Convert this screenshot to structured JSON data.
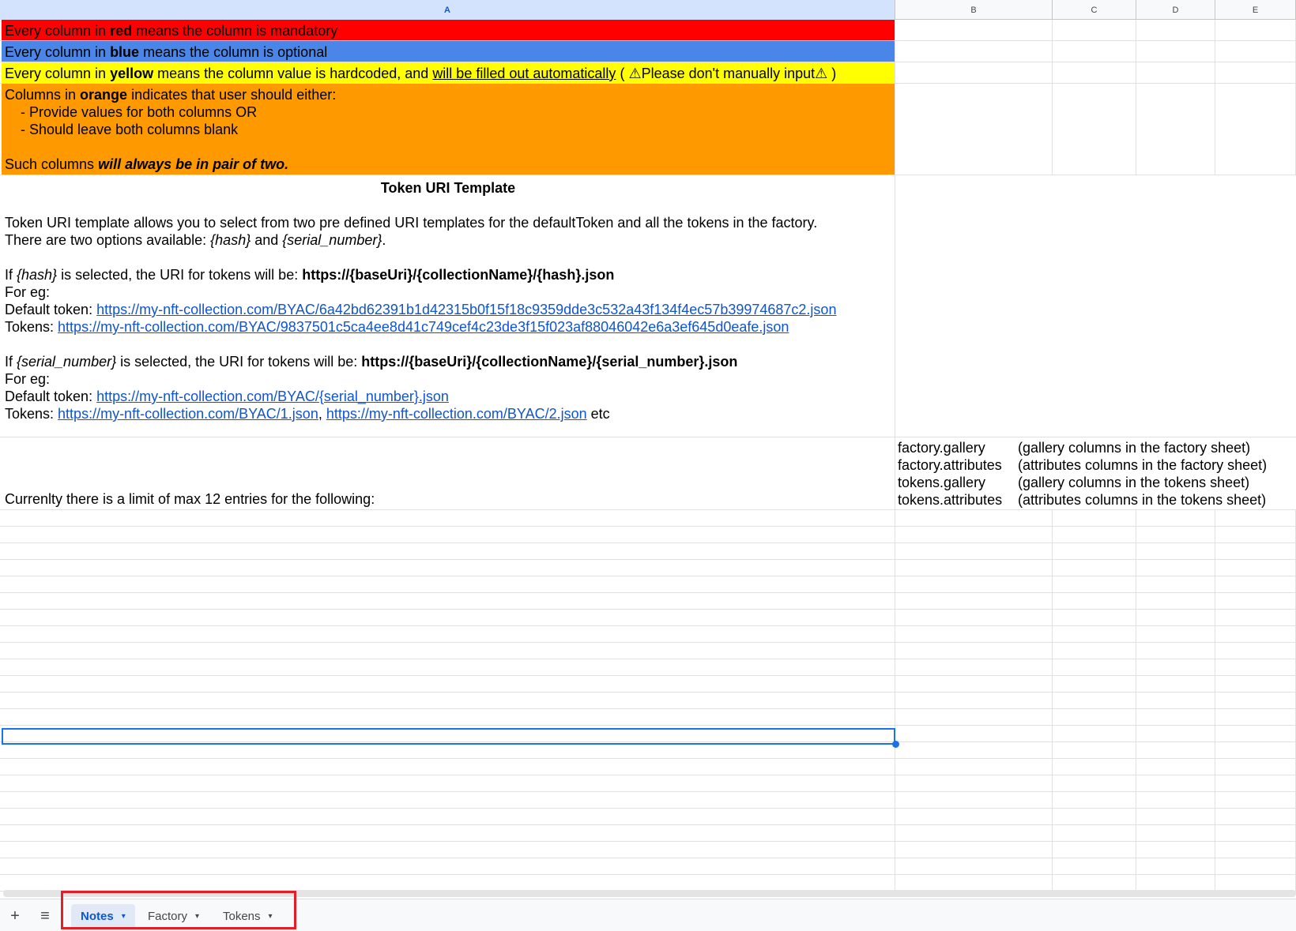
{
  "columns": [
    "A",
    "B",
    "C",
    "D",
    "E"
  ],
  "legend": {
    "red": {
      "pre": "Every column in ",
      "keyword": "red",
      "post": " means the column is mandatory",
      "color": "#ff0000"
    },
    "blue": {
      "pre": "Every column in ",
      "keyword": "blue",
      "post": " means the column is optional",
      "color": "#4a86e8"
    },
    "yellow": {
      "pre": "Every column in ",
      "keyword": "yellow",
      "mid": " means the column value is hardcoded, and ",
      "underlined": "will be filled out automatically",
      "warn_pre": " ( ",
      "warn_text": "Please don't manually input",
      "warn_post": " )",
      "warning_icon": "⚠",
      "color": "#ffff00"
    },
    "orange": {
      "pre": "Columns in ",
      "keyword": "orange",
      "post": " indicates that user should either:",
      "opt1": "- Provide values for both columns OR",
      "opt2": "- Should leave both columns blank",
      "footer_pre": "Such columns ",
      "footer_emph": "will always be in pair of two.",
      "color": "#ff9900"
    }
  },
  "token_uri": {
    "title": "Token URI Template",
    "intro1": "Token URI template allows you to select from two pre defined URI templates for the defaultToken and all the tokens in the factory.",
    "intro2_pre": "There are two options available: ",
    "opt_hash": "{hash}",
    "intro2_and": " and ",
    "opt_serial": "{serial_number}",
    "intro2_end": ".",
    "hash_pre": "If ",
    "hash_mid": " is selected, the URI for tokens will be: ",
    "hash_uri": "https://{baseUri}/{collectionName}/{hash}.json",
    "for_eg": "For eg:",
    "default_label": "Default token: ",
    "tokens_label": "Tokens: ",
    "hash_default_link": "https://my-nft-collection.com/BYAC/6a42bd62391b1d42315b0f15f18c9359dde3c532a43f134f4ec57b39974687c2.json",
    "hash_tokens_link": "https://my-nft-collection.com/BYAC/9837501c5ca4ee8d41c749cef4c23de3f15f023af88046042e6a3ef645d0eafe.json",
    "serial_uri": "https://{baseUri}/{collectionName}/{serial_number}.json",
    "serial_default_link": "https://my-nft-collection.com/BYAC/{serial_number}.json",
    "serial_tokens_link1": "https://my-nft-collection.com/BYAC/1.json",
    "serial_tokens_sep": ", ",
    "serial_tokens_link2": "https://my-nft-collection.com/BYAC/2.json",
    "serial_tokens_end": " etc"
  },
  "limits": {
    "text": "Currenlty there is a limit of max 12 entries for the following:",
    "items": [
      {
        "key": "factory.gallery",
        "desc": "(gallery columns in the factory sheet)"
      },
      {
        "key": "factory.attributes",
        "desc": "(attributes columns in the factory sheet)"
      },
      {
        "key": "tokens.gallery",
        "desc": "(gallery columns in the tokens sheet)"
      },
      {
        "key": "tokens.attributes",
        "desc": "(attributes columns in the tokens sheet)"
      }
    ]
  },
  "sheetbar": {
    "add_icon": "+",
    "menu_icon": "≡",
    "tabs": [
      {
        "label": "Notes",
        "active": true
      },
      {
        "label": "Factory",
        "active": false
      },
      {
        "label": "Tokens",
        "active": false
      }
    ],
    "caret": "▾"
  }
}
